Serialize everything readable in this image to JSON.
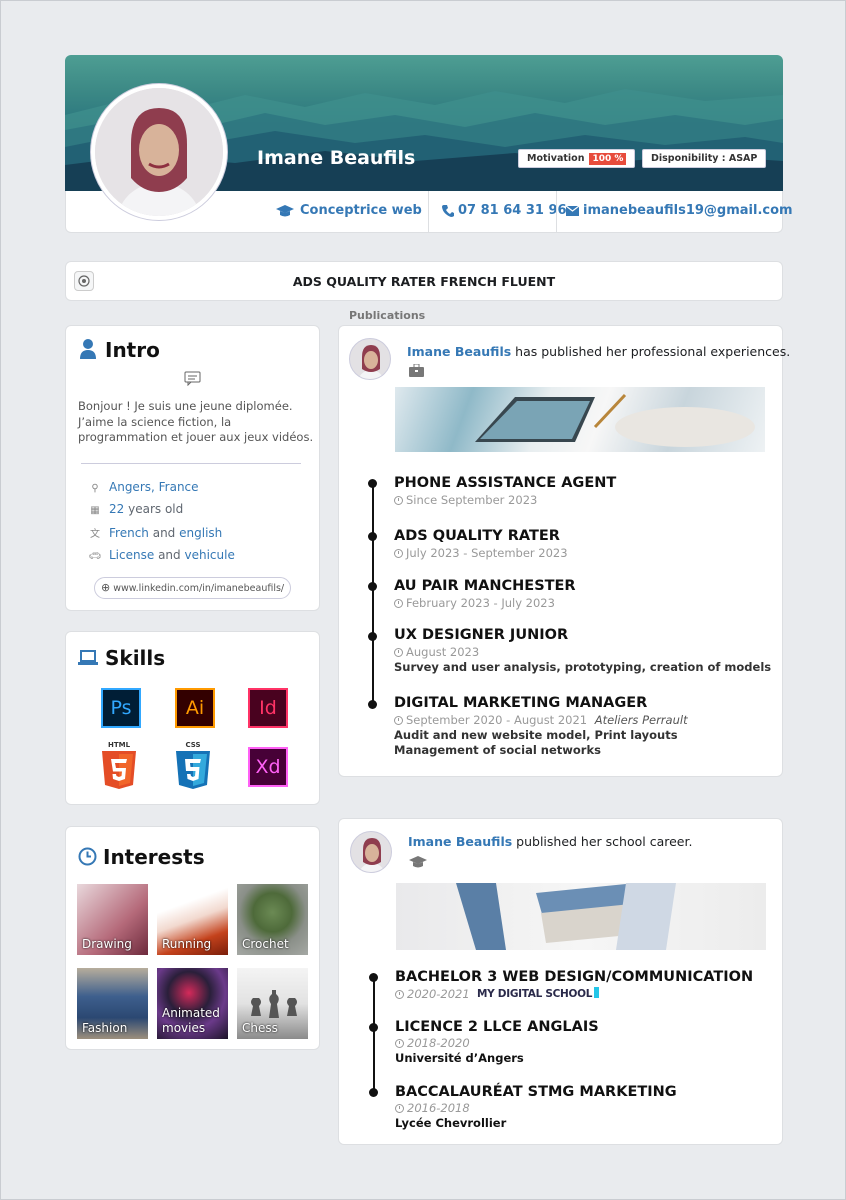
{
  "profile": {
    "name": "Imane Beaufils",
    "motivation_label": "Motivation",
    "motivation_value": "100 %",
    "availability": "Disponibility : ASAP",
    "job": "Conceptrice web",
    "phone": "07 81 64 31 96",
    "email": "imanebeaufils19@gmail.com"
  },
  "headline": "ADS QUALITY RATER FRENCH FLUENT",
  "publications_label": "Publications",
  "intro": {
    "title": "Intro",
    "text": "Bonjour ! Je suis une jeune diplomée. J’aime la science fiction, la programmation et jouer aux jeux vidéos.",
    "location": "Angers, France",
    "age_value": "22",
    "age_suffix": "years old",
    "lang1": "French",
    "and1": "and",
    "lang2": "english",
    "license": "License",
    "and2": "and",
    "vehicle": "vehicule",
    "linkedin": "www.linkedin.com/in/imanebeaufils/"
  },
  "skills": {
    "title": "Skills",
    "items": [
      {
        "label": "Ps",
        "icon": "photoshop-icon",
        "color": "#31a8ff"
      },
      {
        "label": "Ai",
        "icon": "illustrator-icon",
        "color": "#ff9a00"
      },
      {
        "label": "Id",
        "icon": "indesign-icon",
        "color": "#ff3366"
      },
      {
        "label": "HTML",
        "icon": "html5-icon",
        "color": "#e44d26"
      },
      {
        "label": "CSS",
        "icon": "css3-icon",
        "color": "#1572b6"
      },
      {
        "label": "Xd",
        "icon": "xd-icon",
        "color": "#ff61f6"
      }
    ]
  },
  "interests": {
    "title": "Interests",
    "items": [
      "Drawing",
      "Running",
      "Crochet",
      "Fashion",
      "Animated movies",
      "Chess"
    ]
  },
  "pro_post": {
    "author": "Imane Beaufils",
    "text": "has published her professional experiences.",
    "jobs": [
      {
        "title": "PHONE ASSISTANCE AGENT",
        "date": "Since September 2023"
      },
      {
        "title": "ADS QUALITY RATER",
        "date": "July 2023 - September 2023"
      },
      {
        "title": "AU PAIR MANCHESTER",
        "date": "February 2023 - July 2023"
      },
      {
        "title": "UX DESIGNER JUNIOR",
        "date": "August 2023",
        "desc": "Survey and user analysis, prototyping, creation of models"
      },
      {
        "title": "DIGITAL MARKETING MANAGER",
        "date": "September 2020 - August 2021",
        "company": "Ateliers Perrault",
        "desc1": "Audit and new website model, Print layouts",
        "desc2": "Management of social networks"
      }
    ]
  },
  "school_post": {
    "author": "Imane Beaufils",
    "text": "published her school career.",
    "items": [
      {
        "title": "BACHELOR 3 WEB DESIGN/COMMUNICATION",
        "date": "2020-2021",
        "school_logo": "MY DIGITAL SCHOOL"
      },
      {
        "title": "LICENCE 2 LLCE ANGLAIS",
        "date": "2018-2020",
        "school": "Université d’Angers"
      },
      {
        "title": "BACCALAURÉAT STMG MARKETING",
        "date": "2016-2018",
        "school": "Lycée Chevrollier"
      }
    ]
  }
}
